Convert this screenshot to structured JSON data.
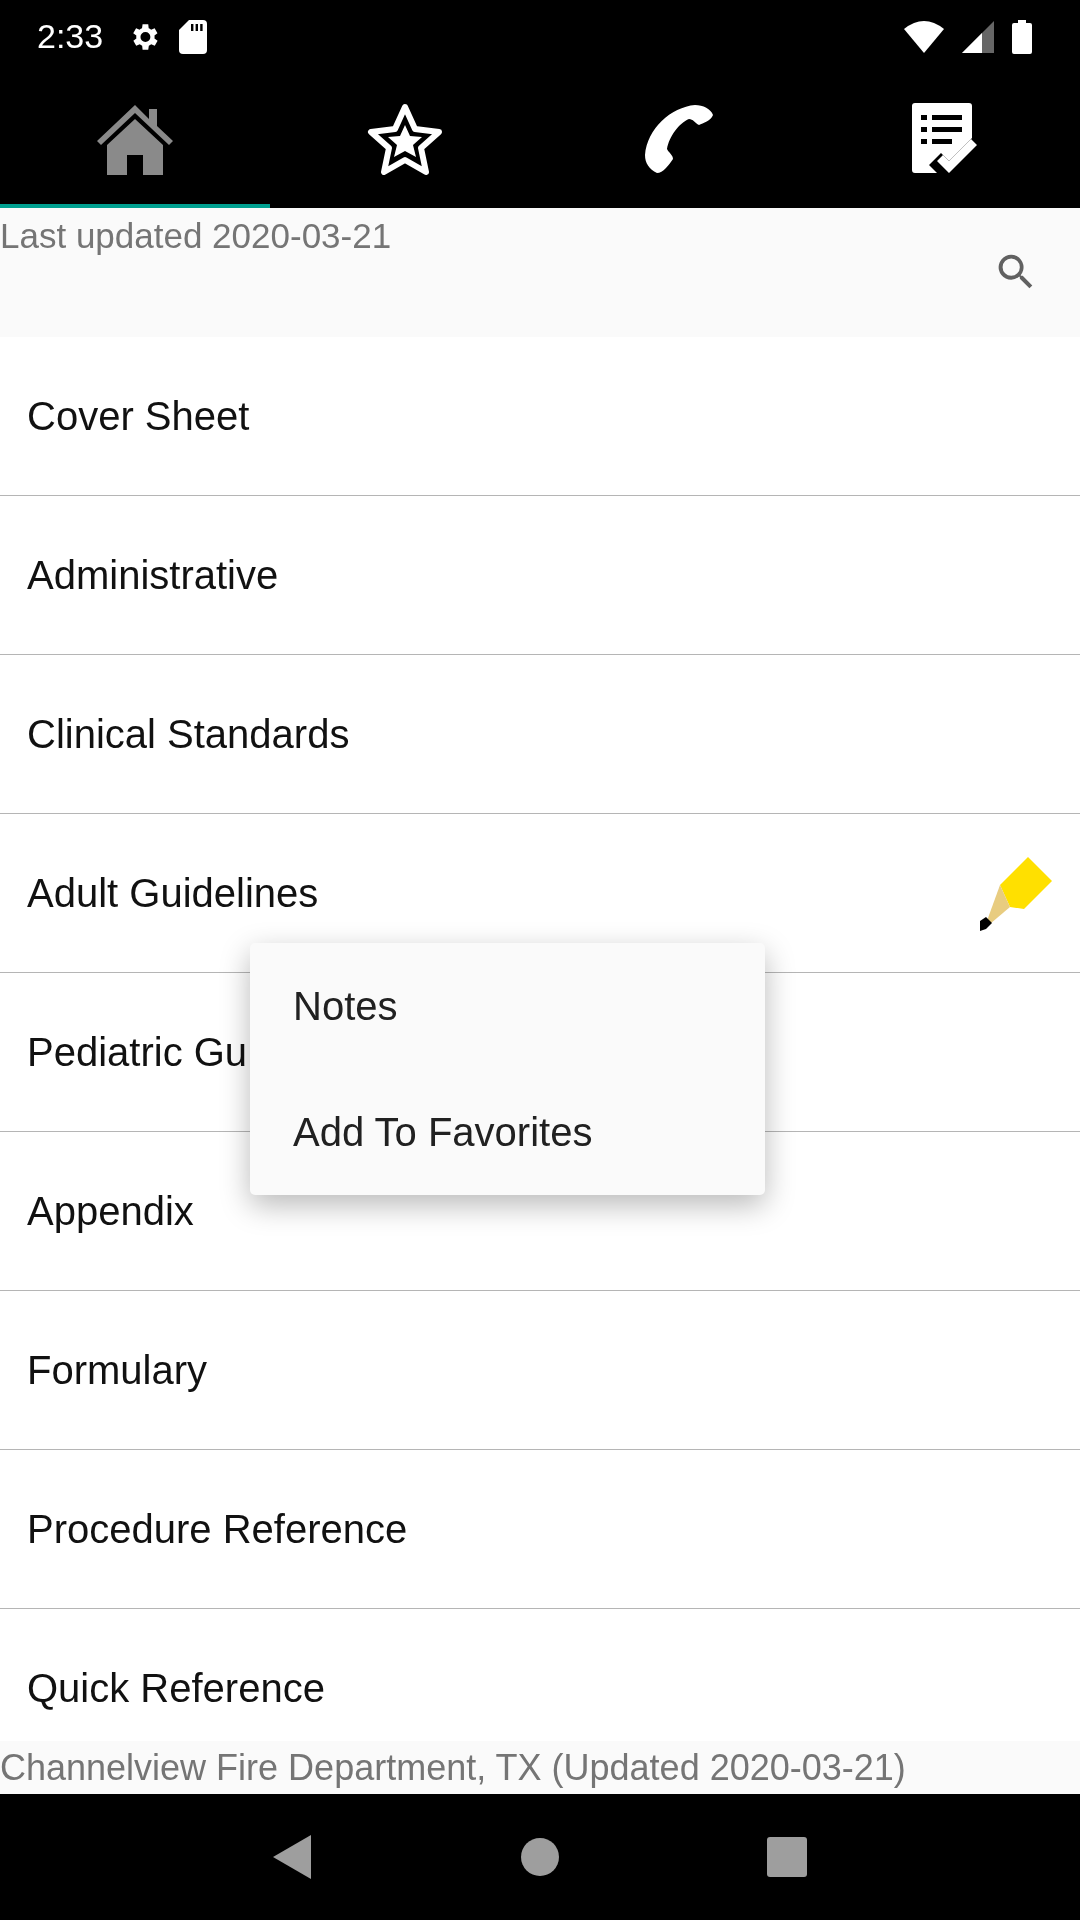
{
  "status_bar": {
    "time": "2:33"
  },
  "tabs": [
    {
      "kind": "home",
      "selected": true
    },
    {
      "kind": "star",
      "selected": false
    },
    {
      "kind": "phone",
      "selected": false
    },
    {
      "kind": "checklist",
      "selected": false
    }
  ],
  "header": {
    "last_updated": "Last updated 2020-03-21"
  },
  "rows": [
    {
      "label": "Cover Sheet",
      "has_note": false
    },
    {
      "label": "Administrative",
      "has_note": false
    },
    {
      "label": "Clinical Standards",
      "has_note": false
    },
    {
      "label": "Adult Guidelines",
      "has_note": true
    },
    {
      "label": "Pediatric Gu",
      "has_note": false
    },
    {
      "label": "Appendix",
      "has_note": false
    },
    {
      "label": "Formulary",
      "has_note": false
    },
    {
      "label": "Procedure Reference",
      "has_note": false
    },
    {
      "label": "Quick Reference",
      "has_note": false
    }
  ],
  "context_menu": {
    "items": [
      "Notes",
      "Add To Favorites"
    ]
  },
  "footer": {
    "text": "Channelview Fire Department, TX (Updated 2020-03-21)"
  }
}
